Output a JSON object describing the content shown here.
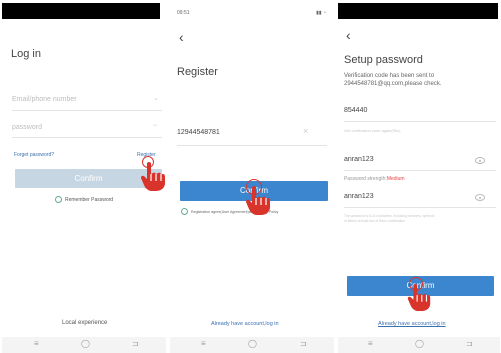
{
  "login": {
    "title": "Log in",
    "phone_placeholder": "Email/phone number",
    "password_placeholder": "password",
    "forget_link": "Forget password?",
    "register_link": "Register",
    "confirm_label": "Confirm",
    "remember_label": "Remember Password",
    "footer": "Local experience"
  },
  "register": {
    "status_time": "09:51",
    "status_icons": "▮▮ ◔",
    "title": "Register",
    "phone_value": "12944548781",
    "clear_icon": "×",
    "confirm_label": "Confirm",
    "agreement_text": "Registration agree(User Agreement)and(Privacy Policy",
    "footer_link": "Already have account,log in"
  },
  "setup": {
    "title": "Setup password",
    "sent_line1": "Verification code has been sent to",
    "sent_line2": "2944548781@qq.com,please check.",
    "code_value": "854440",
    "code_hint": "Get verification code again(55s)",
    "password_value": "anran123",
    "strength_label": "Password strength:",
    "strength_value": "Medium",
    "confirm_value": "anran123",
    "rule_line1": "The password is 8-16 characters, including numbers, symbols",
    "rule_line2": "or letters at least two of them combination",
    "confirm_label": "Confirm",
    "footer_link": "Already have account,log in"
  },
  "nav_icons": {
    "menu": "≡",
    "home": "◯",
    "back": "⊐"
  },
  "colors": {
    "confirm_active": "#3b86cf",
    "confirm_disabled": "#c6d6e2",
    "link": "#3a6fb0",
    "strength": "#e2474b",
    "hand": "#d9342b"
  }
}
